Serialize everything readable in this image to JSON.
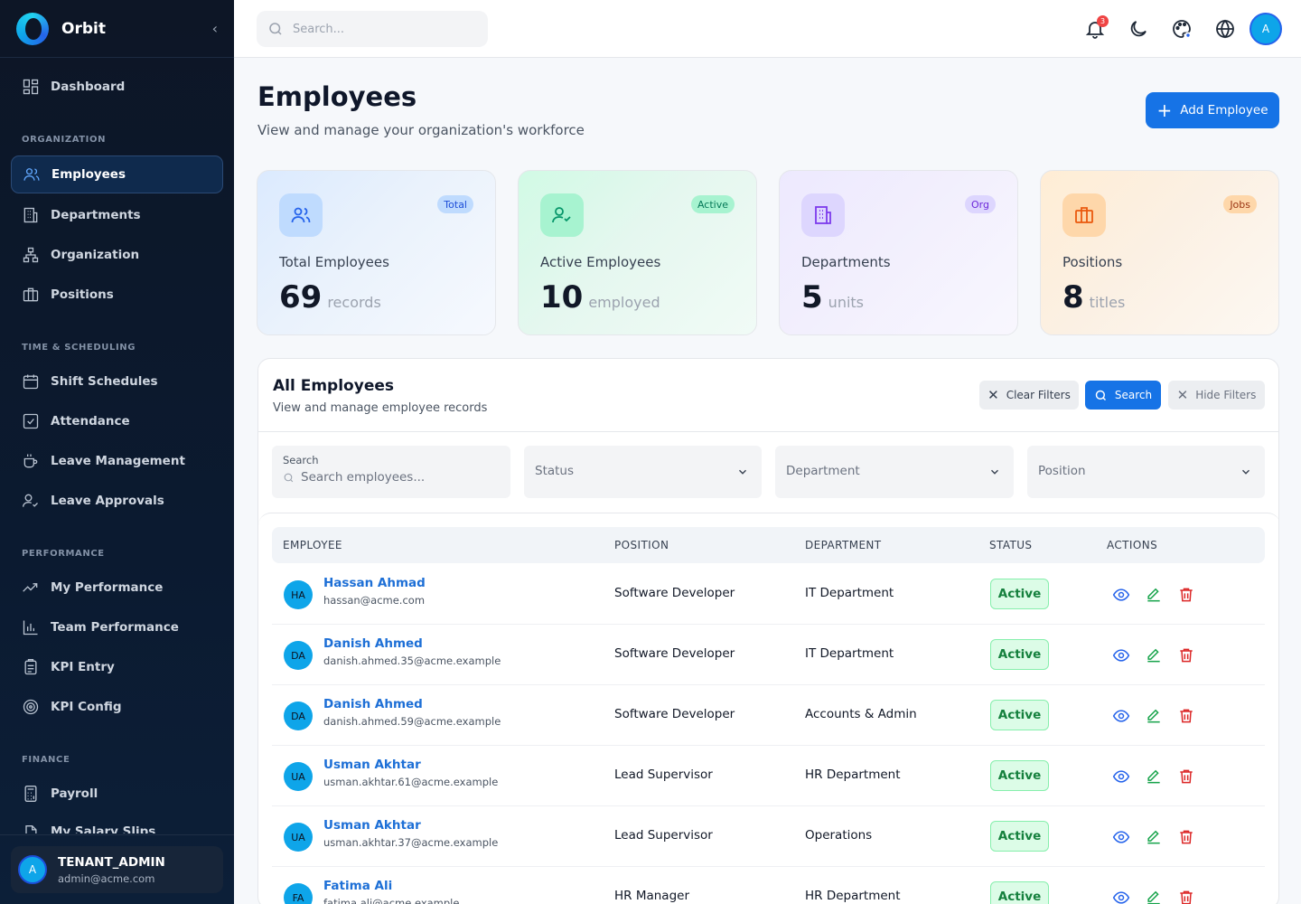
{
  "brand": {
    "name": "Orbit"
  },
  "sidebar": {
    "items": [
      {
        "label": "Dashboard",
        "icon": "dashboard-icon"
      },
      {
        "label": "Employees",
        "icon": "users-icon"
      },
      {
        "label": "Departments",
        "icon": "building-icon"
      },
      {
        "label": "Organization",
        "icon": "org-chart-icon"
      },
      {
        "label": "Positions",
        "icon": "briefcase-icon"
      },
      {
        "label": "Shift Schedules",
        "icon": "calendar-icon"
      },
      {
        "label": "Attendance",
        "icon": "checkbox-icon"
      },
      {
        "label": "Leave Management",
        "icon": "coffee-icon"
      },
      {
        "label": "Leave Approvals",
        "icon": "user-check-icon"
      },
      {
        "label": "My Performance",
        "icon": "trend-icon"
      },
      {
        "label": "Team Performance",
        "icon": "bar-chart-icon"
      },
      {
        "label": "KPI Entry",
        "icon": "clipboard-icon"
      },
      {
        "label": "KPI Config",
        "icon": "target-icon"
      },
      {
        "label": "Payroll",
        "icon": "calculator-icon"
      },
      {
        "label": "My Salary Slips",
        "icon": "file-icon"
      }
    ],
    "sections": [
      "ORGANIZATION",
      "TIME & SCHEDULING",
      "PERFORMANCE",
      "FINANCE"
    ],
    "user": {
      "initial": "A",
      "name": "TENANT_ADMIN",
      "email": "admin@acme.com"
    }
  },
  "topbar": {
    "search_placeholder": "Search...",
    "notification_count": "3",
    "avatar_initial": "A"
  },
  "page": {
    "title": "Employees",
    "subtitle": "View and manage your organization's workforce",
    "add_button": "Add Employee"
  },
  "stats": [
    {
      "tag": "Total",
      "label": "Total Employees",
      "value": "69",
      "unit": "records"
    },
    {
      "tag": "Active",
      "label": "Active Employees",
      "value": "10",
      "unit": "employed"
    },
    {
      "tag": "Org",
      "label": "Departments",
      "value": "5",
      "unit": "units"
    },
    {
      "tag": "Jobs",
      "label": "Positions",
      "value": "8",
      "unit": "titles"
    }
  ],
  "list": {
    "title": "All Employees",
    "subtitle": "View and manage employee records",
    "clear_filters": "Clear Filters",
    "search_button": "Search",
    "hide_filters": "Hide Filters",
    "filters": {
      "search_label": "Search",
      "search_placeholder": "Search employees...",
      "status": "Status",
      "department": "Department",
      "position": "Position"
    },
    "columns": [
      "EMPLOYEE",
      "POSITION",
      "DEPARTMENT",
      "STATUS",
      "ACTIONS"
    ],
    "rows": [
      {
        "initials": "HA",
        "name": "Hassan Ahmad",
        "email": "hassan@acme.com",
        "position": "Software Developer",
        "department": "IT Department",
        "status": "Active"
      },
      {
        "initials": "DA",
        "name": "Danish Ahmed",
        "email": "danish.ahmed.35@acme.example",
        "position": "Software Developer",
        "department": "IT Department",
        "status": "Active"
      },
      {
        "initials": "DA",
        "name": "Danish Ahmed",
        "email": "danish.ahmed.59@acme.example",
        "position": "Software Developer",
        "department": "Accounts & Admin",
        "status": "Active"
      },
      {
        "initials": "UA",
        "name": "Usman Akhtar",
        "email": "usman.akhtar.61@acme.example",
        "position": "Lead Supervisor",
        "department": "HR Department",
        "status": "Active"
      },
      {
        "initials": "UA",
        "name": "Usman Akhtar",
        "email": "usman.akhtar.37@acme.example",
        "position": "Lead Supervisor",
        "department": "Operations",
        "status": "Active"
      },
      {
        "initials": "FA",
        "name": "Fatima Ali",
        "email": "fatima.ali@acme.example",
        "position": "HR Manager",
        "department": "HR Department",
        "status": "Active"
      }
    ]
  }
}
